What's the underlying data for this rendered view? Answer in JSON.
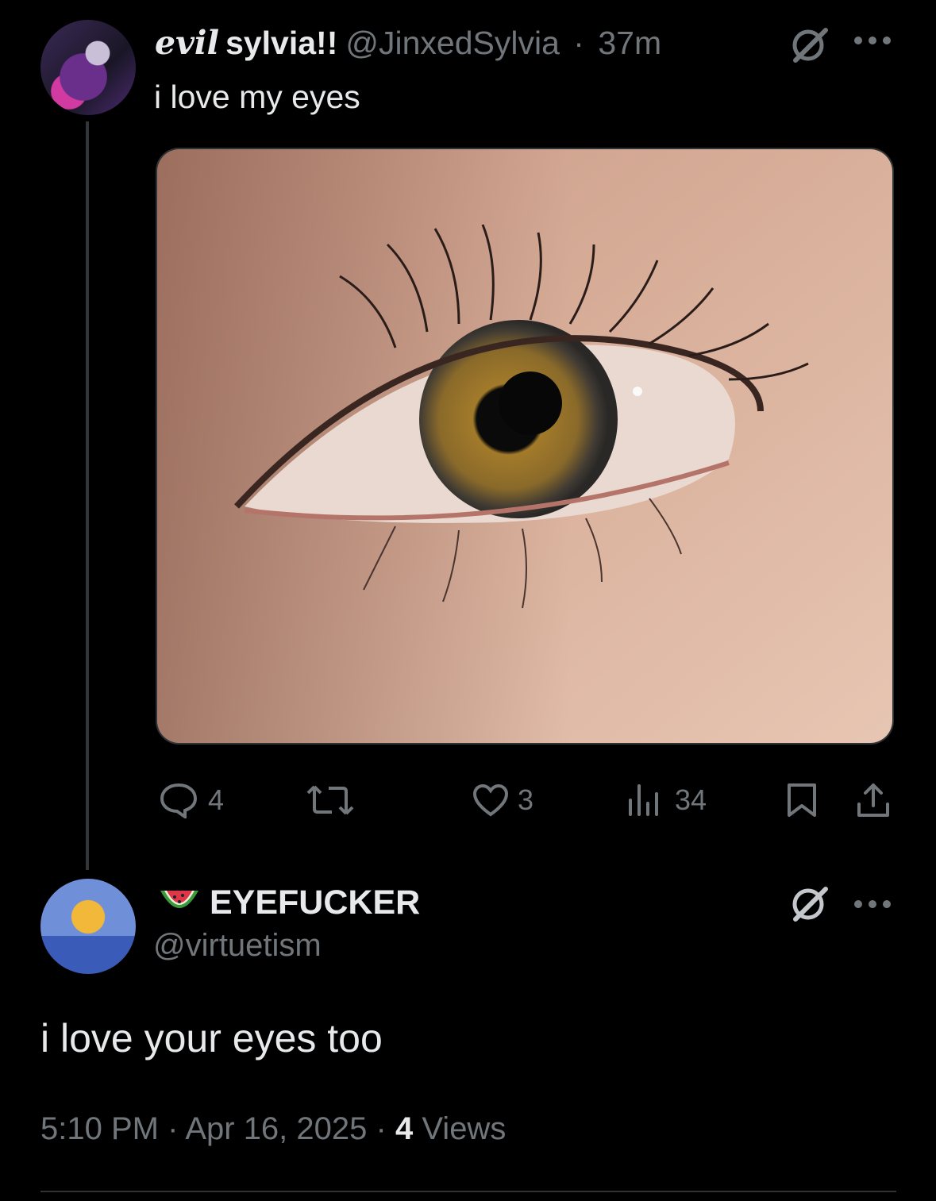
{
  "tweet": {
    "name_prefix": "evil",
    "name": "sylvia!!",
    "handle": "@JinxedSylvia",
    "separator": "·",
    "time": "37m",
    "text": "i love my eyes",
    "actions": {
      "replies": "4",
      "likes": "3",
      "views": "34"
    }
  },
  "reply": {
    "emoji": "watermelon",
    "name": "EYEFUCKER",
    "handle": "@virtuetism",
    "text": "i love your eyes too",
    "time": "5:10 PM",
    "date": "Apr 16, 2025",
    "views_count": "4",
    "views_label": "Views",
    "separator": "·"
  },
  "icons": {
    "grok": "grok-icon",
    "more": "more-icon",
    "reply": "reply-icon",
    "retweet": "retweet-icon",
    "like": "heart-icon",
    "views": "views-icon",
    "bookmark": "bookmark-icon",
    "share": "share-icon"
  }
}
